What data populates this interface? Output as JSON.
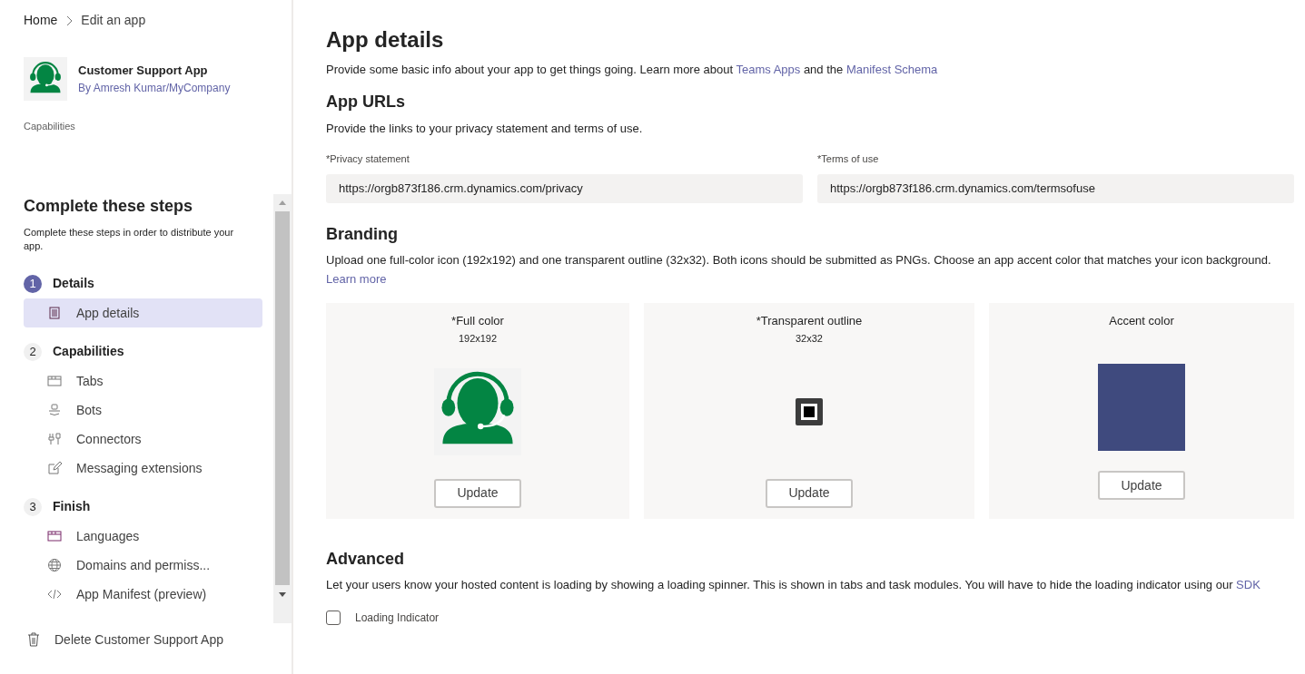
{
  "breadcrumb": [
    {
      "label": "Home"
    },
    {
      "label": "Edit an app"
    }
  ],
  "app": {
    "name": "Customer Support App",
    "author": "By Amresh Kumar/MyCompany",
    "section": "Capabilities"
  },
  "steps_panel": {
    "title": "Complete these steps",
    "description": "Complete these steps in order to distribute your app.",
    "steps": [
      {
        "number": "1",
        "title": "Details",
        "current": true,
        "items": [
          {
            "label": "App details",
            "selected": true
          }
        ]
      },
      {
        "number": "2",
        "title": "Capabilities",
        "current": false,
        "items": [
          {
            "label": "Tabs",
            "selected": false
          },
          {
            "label": "Bots",
            "selected": false
          },
          {
            "label": "Connectors",
            "selected": false
          },
          {
            "label": "Messaging extensions",
            "selected": false
          }
        ]
      },
      {
        "number": "3",
        "title": "Finish",
        "current": false,
        "items": [
          {
            "label": "Languages",
            "selected": false
          },
          {
            "label": "Domains and permiss...",
            "selected": false
          },
          {
            "label": "App Manifest (preview)",
            "selected": false
          }
        ]
      }
    ]
  },
  "delete_action": {
    "label": "Delete Customer Support App"
  },
  "main": {
    "title": "App details",
    "intro": [
      {
        "kind": "text",
        "text": "Provide some basic info about your app to get things going. Learn more about "
      },
      {
        "kind": "link",
        "text": "Teams Apps"
      },
      {
        "kind": "text",
        "text": " and the "
      },
      {
        "kind": "link",
        "text": "Manifest Schema"
      }
    ],
    "urls": {
      "title": "App URLs",
      "description": [
        {
          "kind": "text",
          "text": "Provide the links to your privacy statement and terms of use."
        }
      ],
      "fields": [
        {
          "label": "*Privacy statement",
          "value": "https://orgb873f186.crm.dynamics.com/privacy"
        },
        {
          "label": "*Terms of use",
          "value": "https://orgb873f186.crm.dynamics.com/termsofuse"
        }
      ]
    },
    "branding": {
      "title": "Branding",
      "description": [
        {
          "kind": "text",
          "text": "Upload one full-color icon (192x192) and one transparent outline (32x32). Both icons should be submitted as PNGs. Choose an app accent color that matches your icon background. "
        },
        {
          "kind": "link",
          "text": "Learn more"
        }
      ],
      "cards": [
        {
          "kind": "full",
          "label": "*Full color",
          "size": "192x192",
          "button": "Update"
        },
        {
          "kind": "outline",
          "label": "*Transparent outline",
          "size": "32x32",
          "button": "Update"
        },
        {
          "kind": "accent",
          "label": "Accent color",
          "color": "#3f4a7e",
          "button": "Update"
        }
      ]
    },
    "advanced": {
      "title": "Advanced",
      "description": [
        {
          "kind": "text",
          "text": "Let your users know your hosted content is loading by showing a loading spinner. This is shown in tabs and task modules. You will have to hide the loading indicator using our "
        },
        {
          "kind": "link",
          "text": "SDK"
        }
      ],
      "checkbox": {
        "label": "Loading Indicator",
        "checked": false
      }
    }
  }
}
